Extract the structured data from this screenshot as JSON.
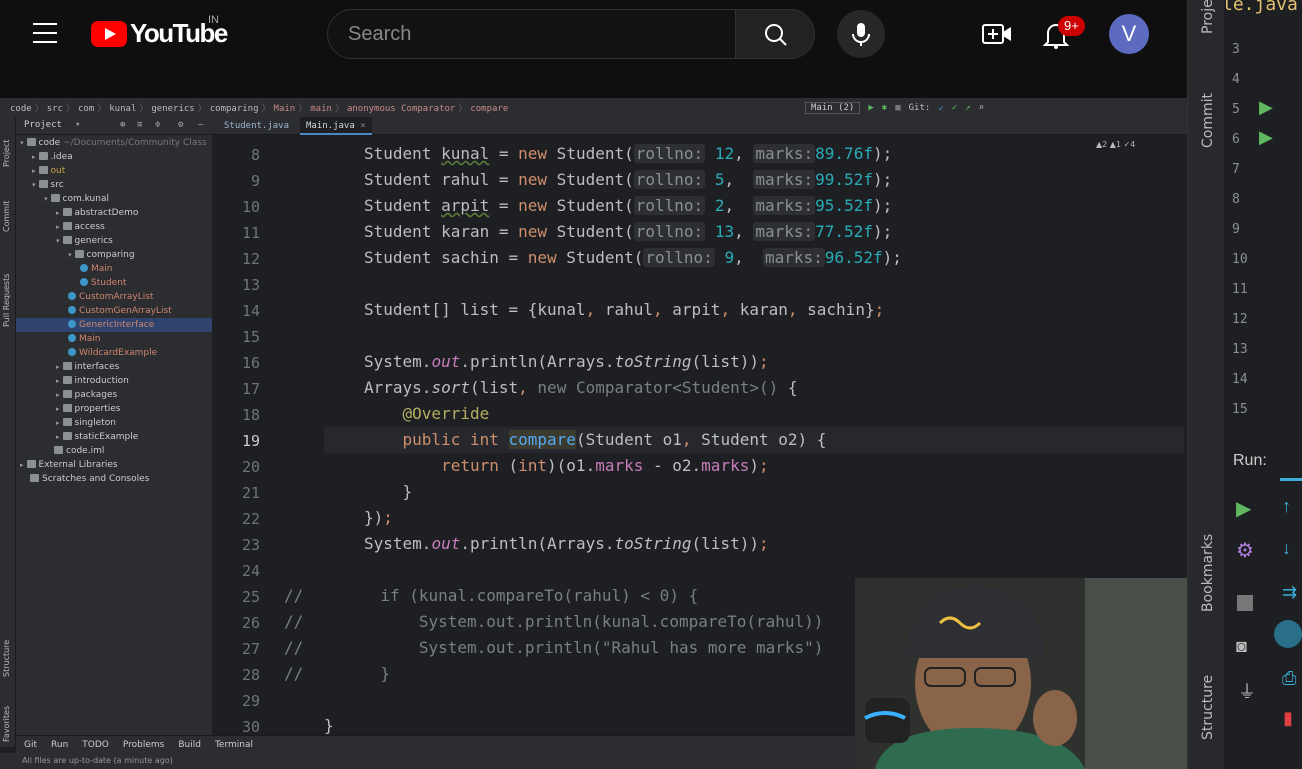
{
  "youtube": {
    "logo_text": "YouTube",
    "country": "IN",
    "search_placeholder": "Search",
    "notifications_badge": "9+",
    "avatar_letter": "V"
  },
  "ide": {
    "breadcrumbs": [
      "code",
      "src",
      "com",
      "kunal",
      "generics",
      "comparing",
      "Main",
      "main",
      "anonymous Comparator",
      "compare"
    ],
    "run_config": "Main (2)",
    "git_label": "Git:",
    "project_tab": "Project",
    "editor_tabs": [
      {
        "label": "Student.java",
        "active": false
      },
      {
        "label": "Main.java",
        "active": true
      }
    ],
    "left_strip": [
      "Project",
      "Commit",
      "Pull Requests",
      "Structure",
      "Favorites"
    ],
    "tree": [
      {
        "label": "code",
        "path": "~/Documents/Community Class",
        "depth": 0,
        "kind": "folder",
        "arrow": "▾"
      },
      {
        "label": ".idea",
        "depth": 1,
        "kind": "folder",
        "arrow": "▸"
      },
      {
        "label": "out",
        "depth": 1,
        "kind": "folder",
        "arrow": "▸",
        "color": "#c9a24a"
      },
      {
        "label": "src",
        "depth": 1,
        "kind": "folder",
        "arrow": "▾"
      },
      {
        "label": "com.kunal",
        "depth": 2,
        "kind": "folder",
        "arrow": "▾"
      },
      {
        "label": "abstractDemo",
        "depth": 3,
        "kind": "folder",
        "arrow": "▸"
      },
      {
        "label": "access",
        "depth": 3,
        "kind": "folder",
        "arrow": "▸"
      },
      {
        "label": "generics",
        "depth": 3,
        "kind": "folder",
        "arrow": "▾"
      },
      {
        "label": "comparing",
        "depth": 4,
        "kind": "folder",
        "arrow": "▾"
      },
      {
        "label": "Main",
        "depth": 5,
        "kind": "class",
        "color": "#d08770"
      },
      {
        "label": "Student",
        "depth": 5,
        "kind": "class",
        "color": "#d08770"
      },
      {
        "label": "CustomArrayList",
        "depth": 4,
        "kind": "class",
        "color": "#d08770"
      },
      {
        "label": "CustomGenArrayList",
        "depth": 4,
        "kind": "class",
        "color": "#d08770"
      },
      {
        "label": "GenericInterface",
        "depth": 4,
        "kind": "class",
        "color": "#d08770",
        "selected": true
      },
      {
        "label": "Main",
        "depth": 4,
        "kind": "class",
        "color": "#d08770"
      },
      {
        "label": "WildcardExample",
        "depth": 4,
        "kind": "class",
        "color": "#d08770"
      },
      {
        "label": "interfaces",
        "depth": 3,
        "kind": "folder",
        "arrow": "▸"
      },
      {
        "label": "introduction",
        "depth": 3,
        "kind": "folder",
        "arrow": "▸"
      },
      {
        "label": "packages",
        "depth": 3,
        "kind": "folder",
        "arrow": "▸"
      },
      {
        "label": "properties",
        "depth": 3,
        "kind": "folder",
        "arrow": "▸"
      },
      {
        "label": "singleton",
        "depth": 3,
        "kind": "folder",
        "arrow": "▸"
      },
      {
        "label": "staticExample",
        "depth": 3,
        "kind": "folder",
        "arrow": "▸"
      },
      {
        "label": "code.iml",
        "depth": 2,
        "kind": "file"
      },
      {
        "label": "External Libraries",
        "depth": 0,
        "kind": "folder",
        "arrow": "▸"
      },
      {
        "label": "Scratches and Consoles",
        "depth": 0,
        "kind": "folder"
      }
    ],
    "line_numbers": [
      "8",
      "9",
      "10",
      "11",
      "12",
      "13",
      "14",
      "15",
      "16",
      "17",
      "18",
      "19",
      "20",
      "21",
      "22",
      "23",
      "24",
      "25",
      "26",
      "27",
      "28",
      "29",
      "30"
    ],
    "inspections": "▲2 ▲1 ✓4",
    "bottom_tools": [
      "Git",
      "Run",
      "TODO",
      "Problems",
      "Build",
      "Terminal"
    ],
    "status": "All files are up-to-date (a minute ago)"
  },
  "right_panel": {
    "file_tail": "le.java",
    "line_numbers": [
      "3",
      "4",
      "5",
      "6",
      "7",
      "8",
      "9",
      "10",
      "11",
      "12",
      "13",
      "14",
      "15"
    ],
    "run_label": "Run:",
    "side_labels": [
      "Project",
      "Commit",
      "Bookmarks",
      "Structure"
    ]
  },
  "colors": {
    "youtube_red": "#ff0000",
    "editor_bg": "#1e1f22",
    "keyword": "#cf8e6d",
    "number": "#2aacb8",
    "field": "#c77dbb"
  }
}
